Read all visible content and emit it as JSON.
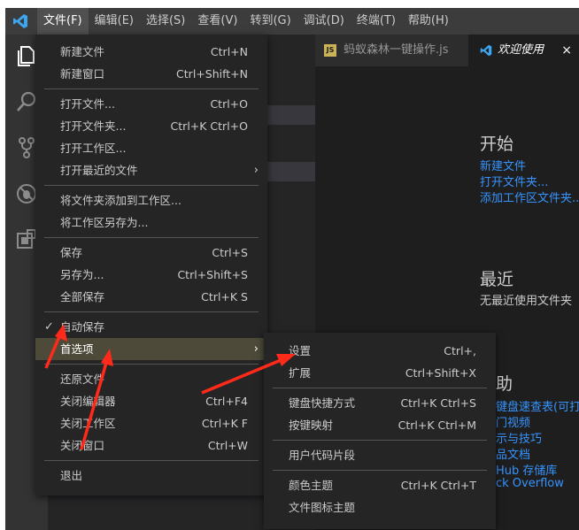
{
  "menubar": {
    "items": [
      "文件(F)",
      "编辑(E)",
      "选择(S)",
      "查看(V)",
      "转到(G)",
      "调试(D)",
      "终端(T)",
      "帮助(H)"
    ]
  },
  "tabs": {
    "tab1": {
      "label": "蚂蚁森林一键操作.js",
      "badge": "JS"
    },
    "tab2": {
      "label": "欢迎使用",
      "close": "×"
    }
  },
  "welcome": {
    "start_heading": "开始",
    "start_links": [
      "新建文件",
      "打开文件夹...",
      "添加工作区文件夹..."
    ],
    "recent_heading": "最近",
    "recent_empty": "无最近使用文件夹",
    "help_heading_partial": "助",
    "help_links_partial": [
      "键盘速查表(可打印",
      "门视频",
      "示与技巧",
      "品文档",
      "Hub 存储库",
      "ck Overflow"
    ]
  },
  "file_menu": {
    "items": [
      {
        "label": "新建文件",
        "shortcut": "Ctrl+N"
      },
      {
        "label": "新建窗口",
        "shortcut": "Ctrl+Shift+N"
      },
      {
        "label": "打开文件...",
        "shortcut": "Ctrl+O"
      },
      {
        "label": "打开文件夹...",
        "shortcut": "Ctrl+K Ctrl+O"
      },
      {
        "label": "打开工作区...",
        "shortcut": ""
      },
      {
        "label": "打开最近的文件",
        "shortcut": "",
        "arrow": "›"
      },
      {
        "label": "将文件夹添加到工作区...",
        "shortcut": ""
      },
      {
        "label": "将工作区另存为...",
        "shortcut": ""
      },
      {
        "label": "保存",
        "shortcut": "Ctrl+S"
      },
      {
        "label": "另存为...",
        "shortcut": "Ctrl+Shift+S"
      },
      {
        "label": "全部保存",
        "shortcut": "Ctrl+K S"
      },
      {
        "label": "自动保存",
        "shortcut": "",
        "check": "✓"
      },
      {
        "label": "首选项",
        "shortcut": "",
        "arrow": "›"
      },
      {
        "label": "还原文件",
        "shortcut": ""
      },
      {
        "label": "关闭编辑器",
        "shortcut": "Ctrl+F4"
      },
      {
        "label": "关闭工作区",
        "shortcut": "Ctrl+K F"
      },
      {
        "label": "关闭窗口",
        "shortcut": "Ctrl+W"
      },
      {
        "label": "退出",
        "shortcut": ""
      }
    ]
  },
  "preferences_menu": {
    "items": [
      {
        "label": "设置",
        "shortcut": "Ctrl+,"
      },
      {
        "label": "扩展",
        "shortcut": "Ctrl+Shift+X"
      },
      {
        "label": "键盘快捷方式",
        "shortcut": "Ctrl+K Ctrl+S"
      },
      {
        "label": "按键映射",
        "shortcut": "Ctrl+K Ctrl+M"
      },
      {
        "label": "用户代码片段",
        "shortcut": ""
      },
      {
        "label": "颜色主题",
        "shortcut": "Ctrl+K Ctrl+T"
      },
      {
        "label": "文件图标主题",
        "shortcut": ""
      }
    ]
  },
  "colors": {
    "accent": "#007acc",
    "highlight": "#4d4a39",
    "annotation": "#ff2a1a",
    "link": "#3794ff"
  }
}
